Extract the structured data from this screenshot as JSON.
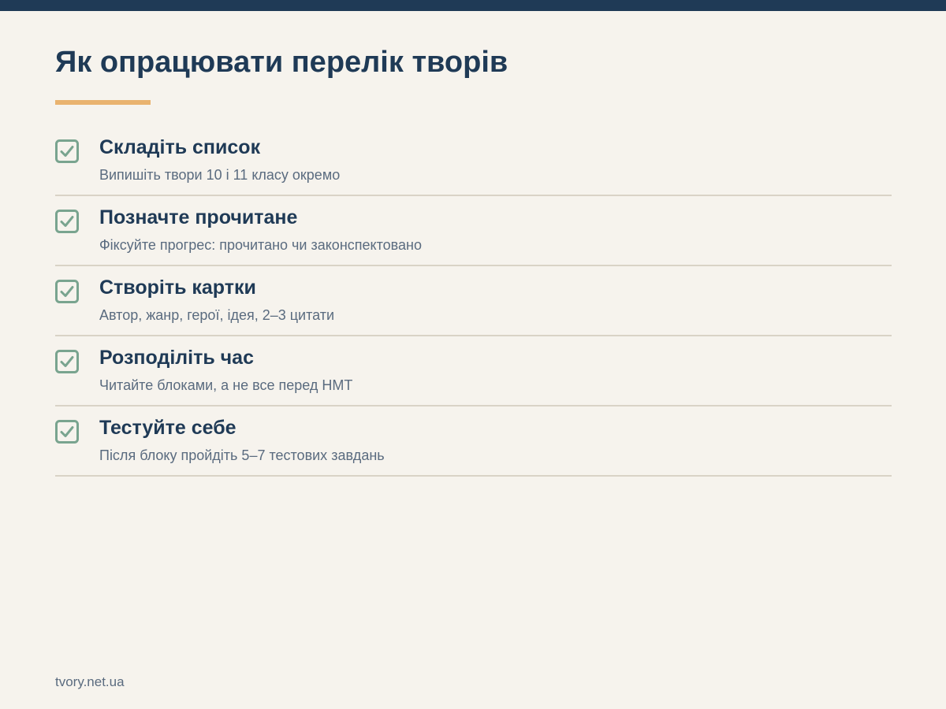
{
  "page": {
    "title": "Як опрацювати перелік творів",
    "footer": "tvory.net.ua"
  },
  "colors": {
    "background": "#f6f3ed",
    "top_bar": "#1f3a56",
    "accent": "#e9b36f",
    "check": "#79a48f",
    "divider": "#d9d3c6",
    "title_text": "#1f3a56",
    "secondary_text": "#5a6b7f"
  },
  "checklist": {
    "icon": "checkbox-checked-icon",
    "items": [
      {
        "title": "Складіть список",
        "description": "Випишіть твори 10 і 11 класу окремо"
      },
      {
        "title": "Позначте прочитане",
        "description": "Фіксуйте прогрес: прочитано чи законспектовано"
      },
      {
        "title": "Створіть картки",
        "description": "Автор, жанр, герої, ідея, 2–3 цитати"
      },
      {
        "title": "Розподіліть час",
        "description": "Читайте блоками, а не все перед НМТ"
      },
      {
        "title": "Тестуйте себе",
        "description": "Після блоку пройдіть 5–7 тестових завдань"
      }
    ]
  }
}
